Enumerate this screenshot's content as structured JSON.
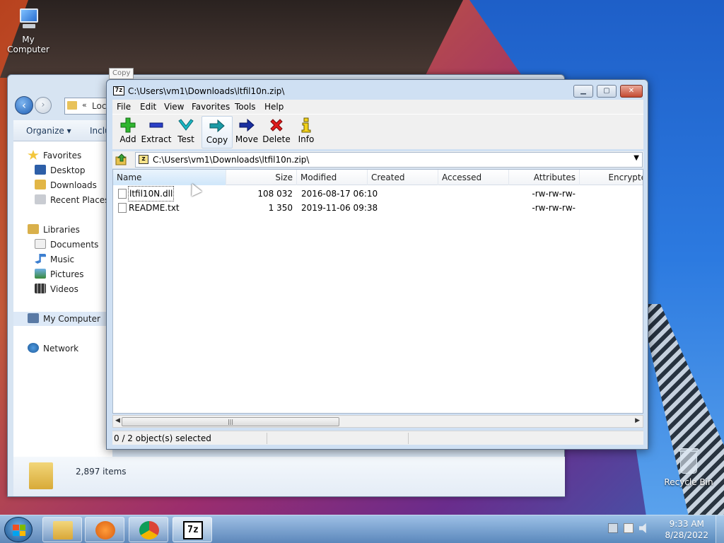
{
  "desktop": {
    "icons": [
      {
        "label": "My Computer"
      },
      {
        "label": "Recycle Bin"
      }
    ]
  },
  "explorer": {
    "address_chevron": "«",
    "address_text": "Loca",
    "toolbar": {
      "organize": "Organize ▾",
      "include": "Inclu"
    },
    "nav": {
      "favorites": "Favorites",
      "desktop": "Desktop",
      "downloads": "Downloads",
      "recent_places": "Recent Places",
      "libraries": "Libraries",
      "documents": "Documents",
      "music": "Music",
      "pictures": "Pictures",
      "videos": "Videos",
      "my_computer": "My Computer",
      "network": "Network"
    },
    "footer_count": "2,897 items"
  },
  "zip": {
    "title": "C:\\Users\\vm1\\Downloads\\ltfil10n.zip\\",
    "app_icon": "7z",
    "menu": [
      "File",
      "Edit",
      "View",
      "Favorites",
      "Tools",
      "Help"
    ],
    "toolbar": {
      "add": "Add",
      "extract": "Extract",
      "test": "Test",
      "copy": "Copy",
      "move": "Move",
      "delete": "Delete",
      "info": "Info"
    },
    "tooltip": "Copy",
    "path": "C:\\Users\\vm1\\Downloads\\ltfil10n.zip\\",
    "columns": {
      "name": "Name",
      "size": "Size",
      "modified": "Modified",
      "created": "Created",
      "accessed": "Accessed",
      "attributes": "Attributes",
      "encrypted": "Encrypte"
    },
    "files": [
      {
        "name": "ltfil10N.dll",
        "size": "108 032",
        "modified": "2016-08-17 06:10",
        "attributes": "-rw-rw-rw-"
      },
      {
        "name": "README.txt",
        "size": "1 350",
        "modified": "2019-11-06 09:38",
        "attributes": "-rw-rw-rw-"
      }
    ],
    "status": "0 / 2 object(s) selected"
  },
  "taskbar": {
    "time": "9:33 AM",
    "date": "8/28/2022",
    "app_7z": "7z"
  },
  "colors": {
    "accent": "#2c7ae0",
    "close_button": "#c44a31"
  }
}
